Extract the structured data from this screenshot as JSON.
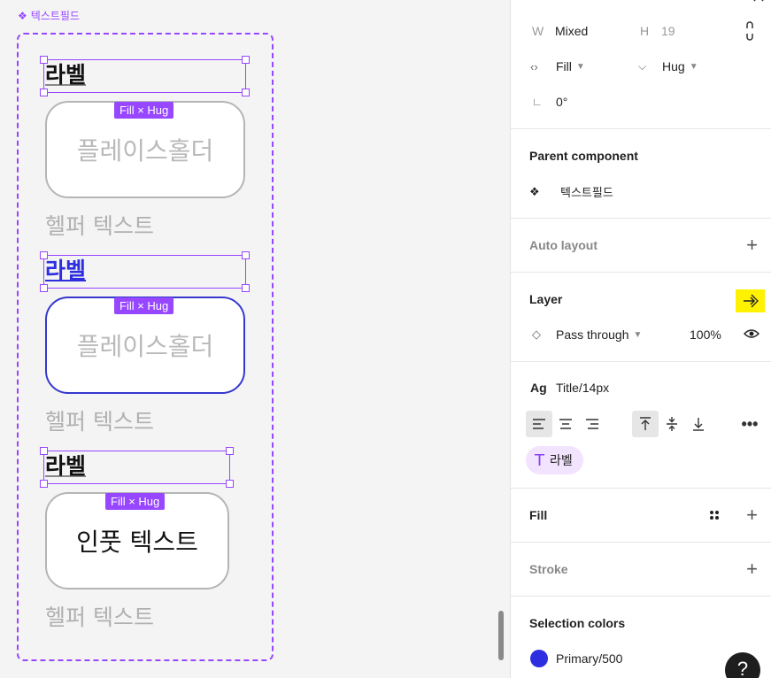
{
  "canvas": {
    "component_title": "텍스트필드",
    "fields": [
      {
        "label": "라벨",
        "input_text": "플레이스홀더",
        "badge": "Fill × Hug",
        "helper": "헬퍼 텍스트",
        "state": "default"
      },
      {
        "label": "라벨",
        "input_text": "플레이스홀더",
        "badge": "Fill × Hug",
        "helper": "헬퍼 텍스트",
        "state": "focused"
      },
      {
        "label": "라벨",
        "input_text": "인풋 텍스트",
        "badge": "Fill × Hug",
        "helper": "헬퍼 텍스트",
        "state": "filled"
      }
    ]
  },
  "panel": {
    "dimensions": {
      "w_label": "W",
      "w_value": "Mixed",
      "h_label": "H",
      "h_value": "19",
      "width_mode": "Fill",
      "height_mode": "Hug",
      "rotation": "0°"
    },
    "parent_component": {
      "title": "Parent component",
      "name": "텍스트필드"
    },
    "auto_layout": {
      "title": "Auto layout"
    },
    "layer": {
      "title": "Layer",
      "blend_mode": "Pass through",
      "opacity": "100%"
    },
    "text": {
      "ag": "Ag",
      "style_name": "Title/14px",
      "variable_label": "라벨"
    },
    "fill": {
      "title": "Fill"
    },
    "stroke": {
      "title": "Stroke"
    },
    "selection_colors": {
      "title": "Selection colors",
      "color_name": "Primary/500",
      "color_hex": "#2d2ee0"
    },
    "help": "?"
  },
  "colors": {
    "selection_purple": "#9747ff",
    "primary": "#2d2ee0",
    "highlight": "#fff200"
  }
}
